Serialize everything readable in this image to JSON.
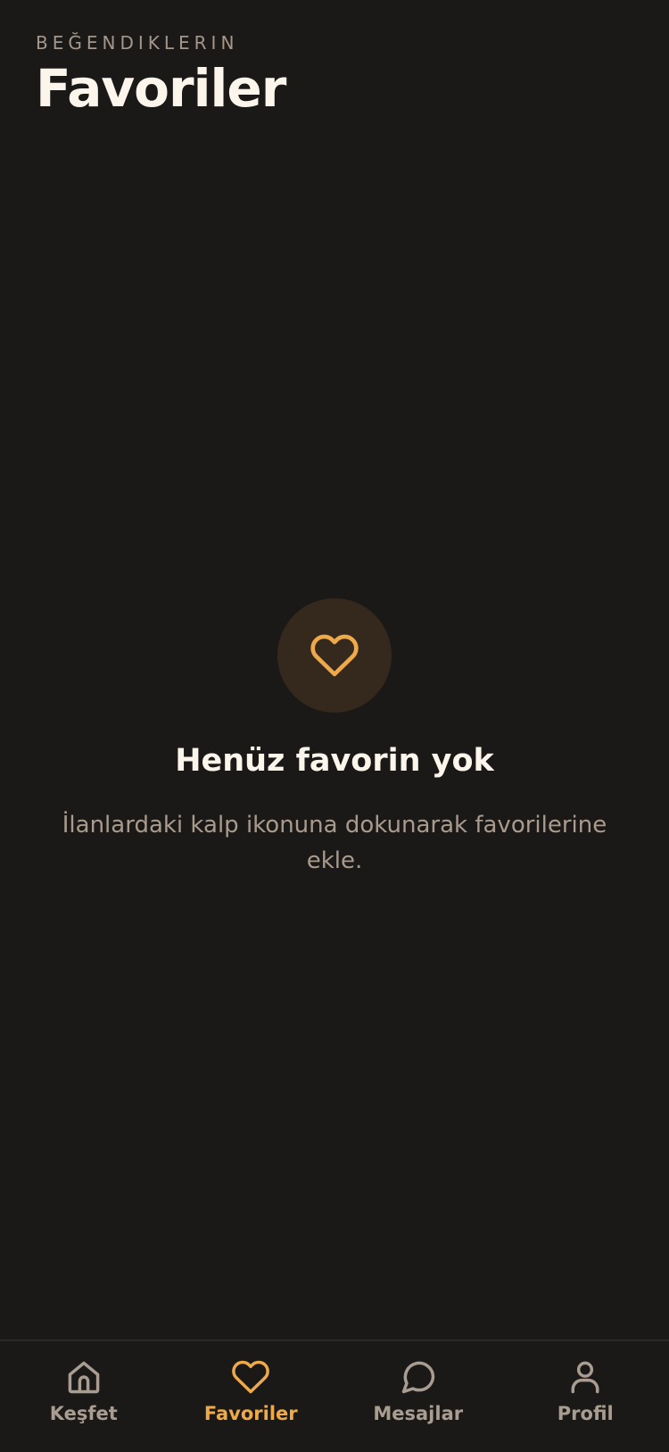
{
  "header": {
    "eyebrow": "BEĞENDIKLERIN",
    "title": "Favoriler"
  },
  "empty_state": {
    "icon": "heart-icon",
    "title": "Henüz favorin yok",
    "description": "İlanlardaki kalp ikonuna dokunarak favorilerine ekle."
  },
  "tabbar": {
    "items": [
      {
        "label": "Keşfet",
        "icon": "home-icon",
        "active": false
      },
      {
        "label": "Favoriler",
        "icon": "heart-icon",
        "active": true
      },
      {
        "label": "Mesajlar",
        "icon": "chat-bubble-icon",
        "active": false
      },
      {
        "label": "Profil",
        "icon": "user-icon",
        "active": false
      }
    ]
  },
  "colors": {
    "background": "#1b1918",
    "accent": "#eeaa4a",
    "muted_text": "#a99a8c",
    "primary_text": "#fbf5ec",
    "icon_circle": "#35291e"
  }
}
